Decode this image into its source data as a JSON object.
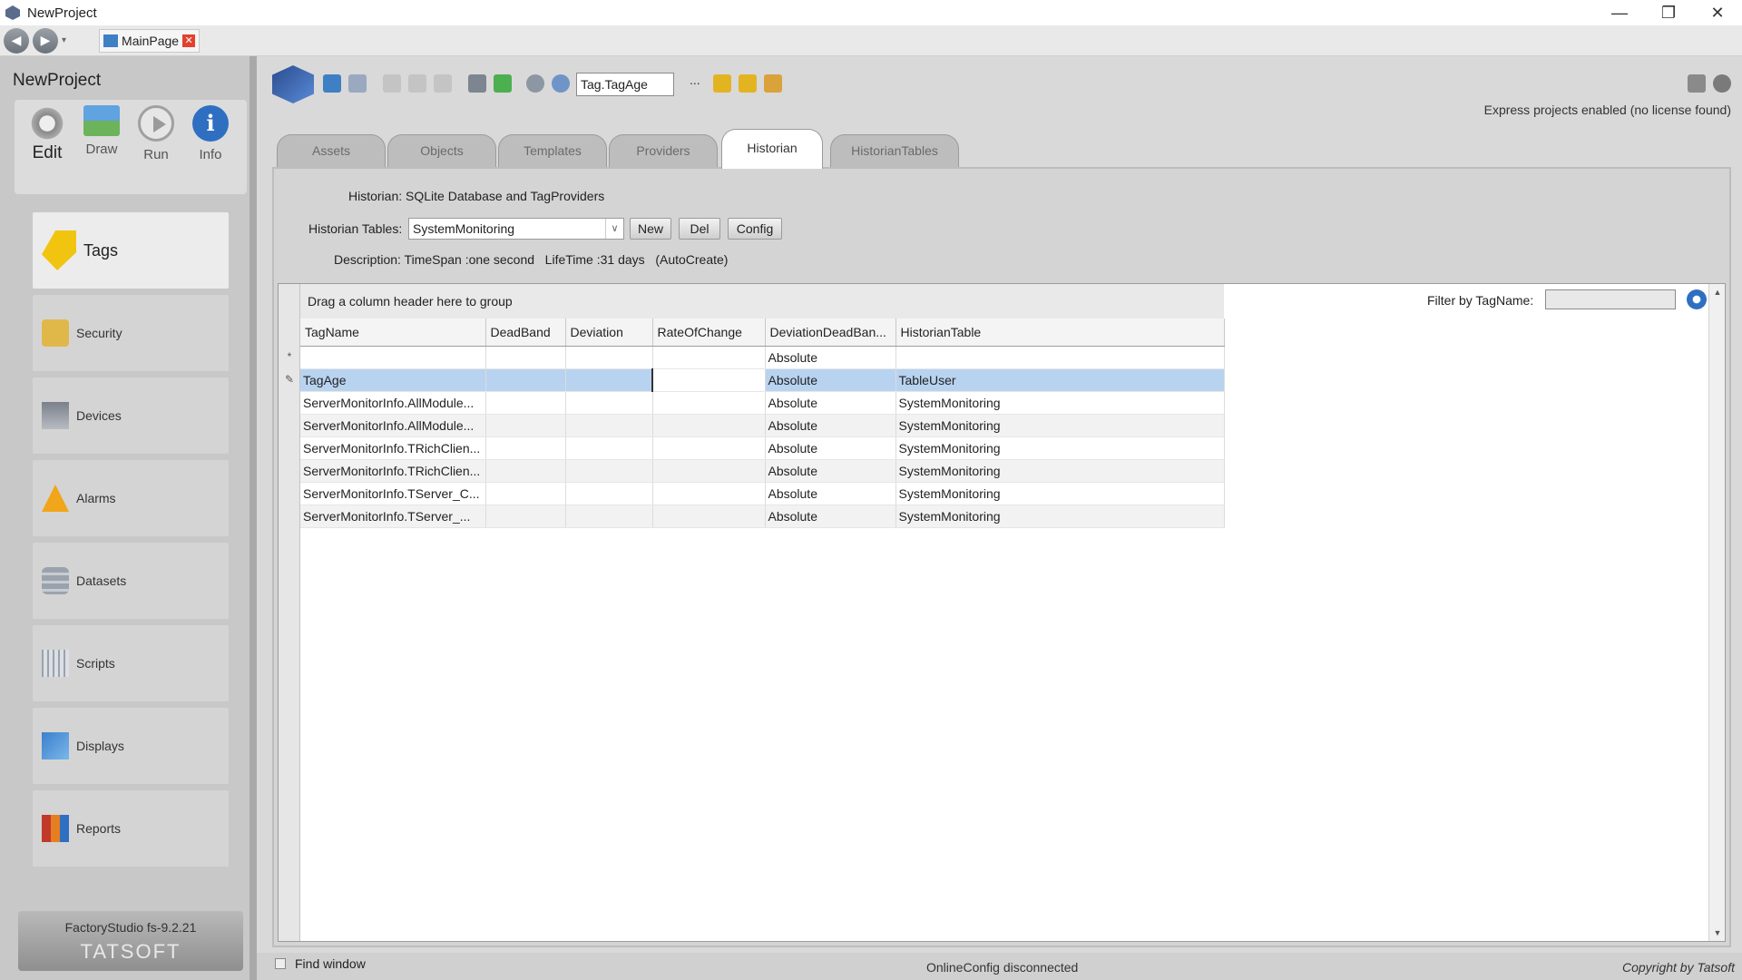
{
  "window": {
    "title": "NewProject",
    "controls": [
      "—",
      "❐",
      "✕"
    ]
  },
  "navbar": {
    "back": "◀",
    "forward": "▶",
    "dropdown": "▾",
    "doc_tab_label": "MainPage",
    "doc_tab_close": "✕"
  },
  "sidebar": {
    "project_name": "NewProject",
    "modes": [
      {
        "label": "Edit",
        "icon": "gear-icon"
      },
      {
        "label": "Draw",
        "icon": "draw-icon"
      },
      {
        "label": "Run",
        "icon": "play-icon"
      },
      {
        "label": "Info",
        "icon": "info-icon"
      }
    ],
    "info_glyph": "i",
    "items": [
      {
        "label": "Tags",
        "icon": "tag-icon"
      },
      {
        "label": "Security",
        "icon": "lock-icon"
      },
      {
        "label": "Devices",
        "icon": "devices-icon"
      },
      {
        "label": "Alarms",
        "icon": "warning-icon"
      },
      {
        "label": "Datasets",
        "icon": "database-icon"
      },
      {
        "label": "Scripts",
        "icon": "scripts-icon"
      },
      {
        "label": "Displays",
        "icon": "displays-icon"
      },
      {
        "label": "Reports",
        "icon": "reports-icon"
      }
    ],
    "version": "FactoryStudio fs-9.2.21",
    "brand": "TATSOFT"
  },
  "toolbar": {
    "tag_field": "Tag.TagAge",
    "more": "...",
    "license": "Express projects enabled (no license found)"
  },
  "tabs": [
    "Assets",
    "Objects",
    "Templates",
    "Providers",
    "Historian",
    "HistorianTables"
  ],
  "historian": {
    "title": "Historian: SQLite Database and TagProviders",
    "tables_label": "Historian Tables:",
    "tables_value": "SystemMonitoring",
    "select_arrow": "∨",
    "new_btn": "New",
    "del_btn": "Del",
    "config_btn": "Config",
    "description": "Description: TimeSpan :one second   LifeTime :31 days   (AutoCreate)"
  },
  "grid": {
    "group_hint": "Drag a column header here to group",
    "filter_label": "Filter by TagName:",
    "filter_value": "",
    "columns": [
      "TagName",
      "DeadBand",
      "Deviation",
      "RateOfChange",
      "DeviationDeadBan...",
      "HistorianTable"
    ],
    "rows": [
      [
        "",
        "",
        "",
        "",
        "Absolute",
        ""
      ],
      [
        "TagAge",
        "",
        "",
        "",
        "Absolute",
        "TableUser"
      ],
      [
        "ServerMonitorInfo.AllModule...",
        "",
        "",
        "",
        "Absolute",
        "SystemMonitoring"
      ],
      [
        "ServerMonitorInfo.AllModule...",
        "",
        "",
        "",
        "Absolute",
        "SystemMonitoring"
      ],
      [
        "ServerMonitorInfo.TRichClien...",
        "",
        "",
        "",
        "Absolute",
        "SystemMonitoring"
      ],
      [
        "ServerMonitorInfo.TRichClien...",
        "",
        "",
        "",
        "Absolute",
        "SystemMonitoring"
      ],
      [
        "ServerMonitorInfo.TServer_C...",
        "",
        "",
        "",
        "Absolute",
        "SystemMonitoring"
      ],
      [
        "ServerMonitorInfo.TServer_...",
        "",
        "",
        "",
        "Absolute",
        "SystemMonitoring"
      ]
    ],
    "new_row_marker": "*",
    "edit_row_marker": "✎",
    "scroll_up": "▲",
    "scroll_down": "▼"
  },
  "status": {
    "find_window": "Find window",
    "online": "OnlineConfig disconnected",
    "copyright": "Copyright by Tatsoft"
  }
}
